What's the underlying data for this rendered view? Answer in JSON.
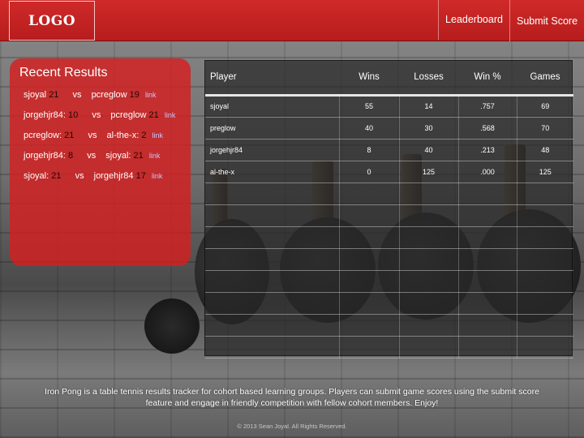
{
  "header": {
    "logo": "LOGO",
    "nav": {
      "leaderboard": "Leaderboard",
      "submit_score": "Submit Score"
    }
  },
  "recent_results": {
    "title": "Recent Results",
    "items": [
      {
        "player1": "sjoyal",
        "score1": "21",
        "vs": "vs",
        "player2": "pcreglow",
        "score2": "19",
        "link": "link"
      },
      {
        "player1": "jorgehjr84:",
        "score1": "10",
        "vs": "vs",
        "player2": "pcreglow",
        "score2": "21",
        "link": "link"
      },
      {
        "player1": "pcreglow:",
        "score1": "21",
        "vs": "vs",
        "player2": "al-the-x:",
        "score2": "2",
        "link": "link"
      },
      {
        "player1": "jorgehjr84:",
        "score1": "8",
        "vs": "vs",
        "player2": "sjoyal:",
        "score2": "21",
        "link": "link"
      },
      {
        "player1": "sjoyal:",
        "score1": "21",
        "vs": "vs",
        "player2": "jorgehjr84",
        "score2": "17",
        "link": "link"
      }
    ]
  },
  "leaderboard": {
    "columns": [
      "Player",
      "Wins",
      "Losses",
      "Win %",
      "Games"
    ],
    "rows": [
      [
        "sjoyal",
        "55",
        "14",
        ".757",
        "69"
      ],
      [
        "preglow",
        "40",
        "30",
        ".568",
        "70"
      ],
      [
        "jorgehjr84",
        "8",
        "40",
        ".213",
        "48"
      ],
      [
        "al-the-x",
        "0",
        "125",
        ".000",
        "125"
      ],
      [
        "",
        "",
        "",
        "",
        ""
      ],
      [
        "",
        "",
        "",
        "",
        ""
      ],
      [
        "",
        "",
        "",
        "",
        ""
      ],
      [
        "",
        "",
        "",
        "",
        ""
      ],
      [
        "",
        "",
        "",
        "",
        ""
      ],
      [
        "",
        "",
        "",
        "",
        ""
      ],
      [
        "",
        "",
        "",
        "",
        ""
      ],
      [
        "",
        "",
        "",
        "",
        ""
      ]
    ]
  },
  "footer": {
    "about": "Iron Pong is a table tennis results tracker for cohort based learning groups. Players can submit game scores using the submit score feature and engage in friendly competition with fellow cohort members. Enjoy!",
    "copyright": "© 2013 Sean Joyal. All Rights Reserved."
  },
  "colors": {
    "brand_red": "#c62222",
    "panel_red": "#d61e1e"
  }
}
